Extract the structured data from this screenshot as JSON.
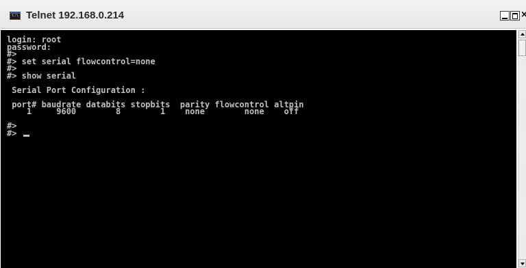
{
  "window": {
    "title": "Telnet 192.168.0.214",
    "app_icon": "console-icon",
    "app_icon_text": "C:\\",
    "controls": {
      "minimize": "minimize-icon",
      "maximize": "maximize-icon",
      "close": "close-icon",
      "close_glyph": "×"
    }
  },
  "console": {
    "lines": [
      "login: root",
      "password:",
      "#>",
      "#> set serial flowcontrol=none",
      "#>",
      "#> show serial",
      "",
      " Serial Port Configuration :",
      "",
      " port# baudrate databits stopbits  parity flowcontrol altpin",
      "    1     9600        8        1    none        none    off",
      "",
      "#>",
      "#> "
    ],
    "cursor": "underscore"
  },
  "colors": {
    "console_background": "#000000",
    "console_text": "#c0c0c0",
    "titlebar": "#eeeeee"
  }
}
